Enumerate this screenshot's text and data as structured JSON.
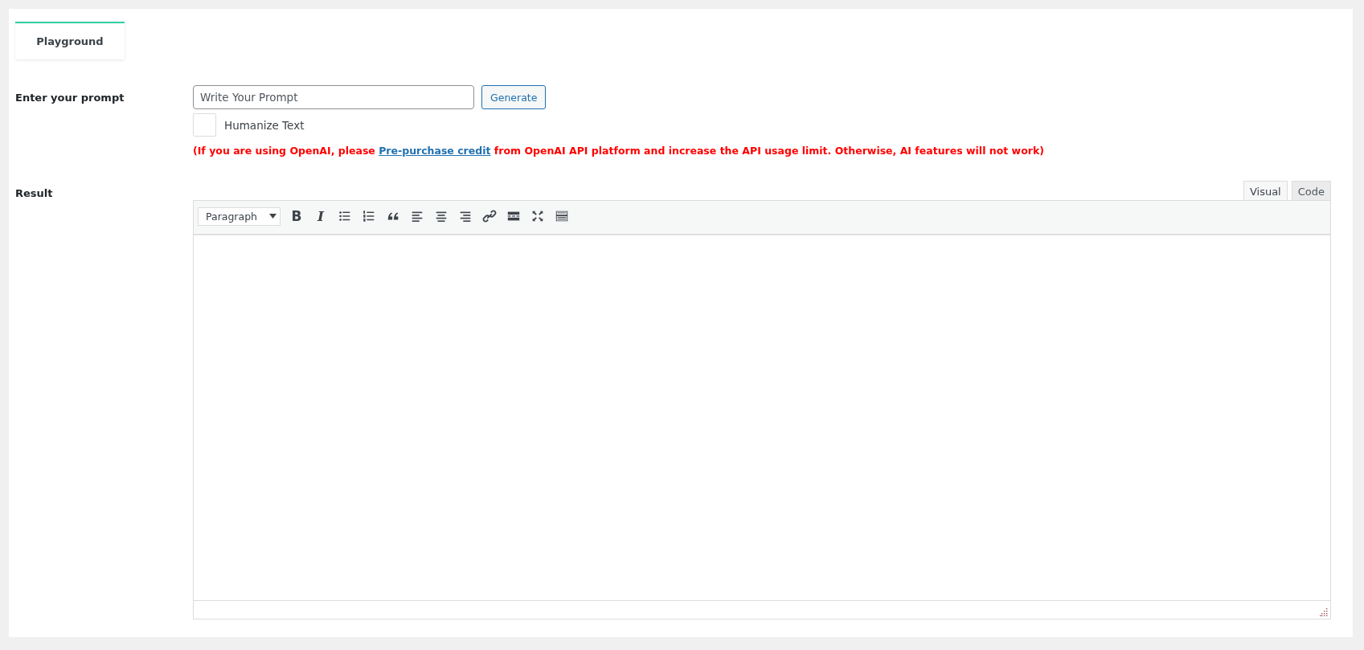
{
  "tabs": [
    {
      "label": "Playground",
      "selected": true
    }
  ],
  "prompt": {
    "label": "Enter your prompt",
    "placeholder": "Write Your Prompt",
    "button": "Generate"
  },
  "humanize": {
    "label": "Humanize Text",
    "checked": false
  },
  "notice": {
    "before": "(If you are using OpenAI, please ",
    "link": "Pre-purchase credit",
    "after": " from OpenAI API platform and increase the API usage limit. Otherwise, AI features will not work)"
  },
  "result": {
    "label": "Result",
    "editor_tabs": [
      {
        "label": "Visual",
        "selected": true
      },
      {
        "label": "Code",
        "selected": false
      }
    ],
    "format": "Paragraph",
    "toolbar": [
      {
        "kind": "bold",
        "glyph": "B"
      },
      {
        "kind": "italic",
        "glyph": "I"
      },
      {
        "kind": "bullets"
      },
      {
        "kind": "numbers"
      },
      {
        "kind": "quote"
      },
      {
        "kind": "align-left"
      },
      {
        "kind": "align-center"
      },
      {
        "kind": "align-right"
      },
      {
        "kind": "link"
      },
      {
        "kind": "more"
      },
      {
        "kind": "fullscreen"
      },
      {
        "kind": "kitchen"
      }
    ]
  }
}
